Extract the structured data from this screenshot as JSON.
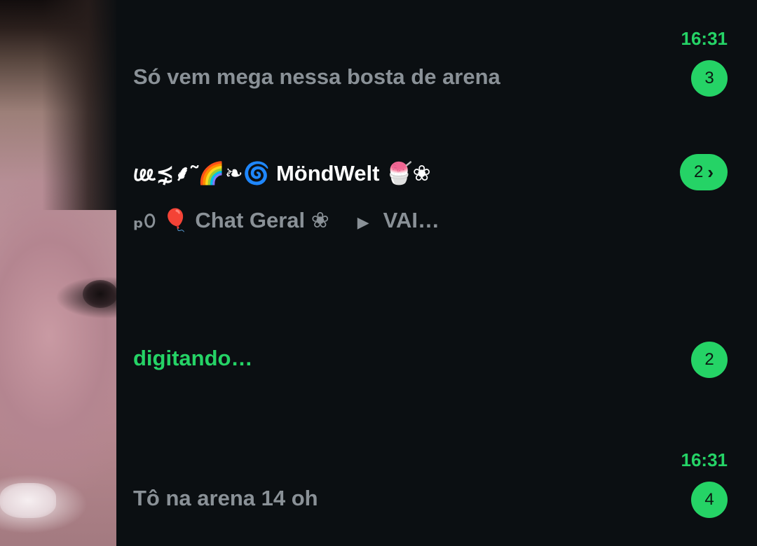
{
  "avatar": {
    "label": ""
  },
  "chats": [
    {
      "time": "16:31",
      "preview": "Só vem mega nessa bosta de arena",
      "unread": "3"
    },
    {
      "title": "𖺙⋨⸙˜🌈❧🌀 MöndWelt 🍧❀",
      "preview_sender": "ₚ௦ 🎈 Chat Geral ❀",
      "preview_arrow": "▶",
      "preview_text": "VAI…",
      "unread": "2",
      "badge_icon": "chevron-right-icon"
    },
    {
      "status": "digitando…",
      "unread": "2"
    },
    {
      "time": "16:31",
      "preview": "Tô na arena 14 oh",
      "unread": "4"
    }
  ],
  "colors": {
    "accent": "#25d366",
    "background": "#0b0f12",
    "muted_text": "#8a9197",
    "title_text": "#ffffff"
  }
}
